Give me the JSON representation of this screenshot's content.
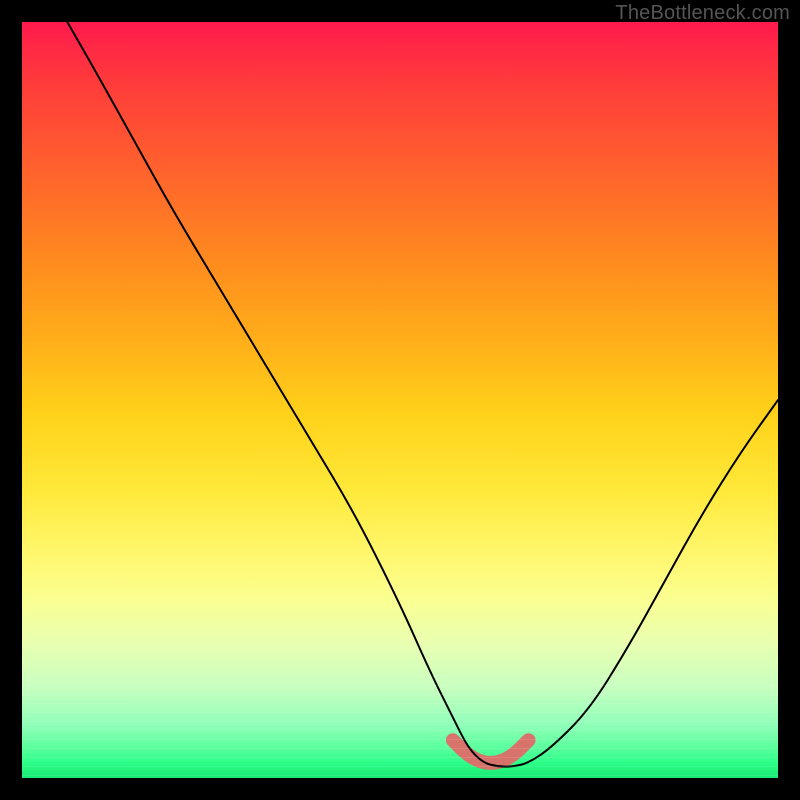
{
  "watermark": "TheBottleneck.com",
  "chart_data": {
    "type": "line",
    "title": "",
    "xlabel": "",
    "ylabel": "",
    "xlim": [
      0,
      100
    ],
    "ylim": [
      0,
      100
    ],
    "grid": false,
    "series": [
      {
        "name": "bottleneck-curve",
        "x": [
          6,
          10,
          15,
          20,
          26,
          32,
          38,
          44,
          50,
          54,
          57,
          59,
          61,
          63,
          65,
          67,
          70,
          75,
          80,
          85,
          90,
          95,
          100
        ],
        "values": [
          100,
          93,
          84,
          75,
          65,
          55,
          45,
          35,
          23,
          14,
          8,
          4,
          2,
          1.5,
          1.5,
          2,
          4,
          9,
          17,
          26,
          35,
          43,
          50
        ]
      }
    ],
    "highlight": {
      "name": "trough-band",
      "x": [
        57,
        59,
        61,
        63,
        65,
        67
      ],
      "values": [
        5,
        3,
        2,
        2,
        3,
        5
      ],
      "color": "#d8736b",
      "stroke_width": 14
    },
    "gradient_stops": [
      {
        "pos": 0.0,
        "color": "#ff1a4d"
      },
      {
        "pos": 0.5,
        "color": "#ffd21a"
      },
      {
        "pos": 0.8,
        "color": "#f6ffa0"
      },
      {
        "pos": 1.0,
        "color": "#18e874"
      }
    ]
  }
}
